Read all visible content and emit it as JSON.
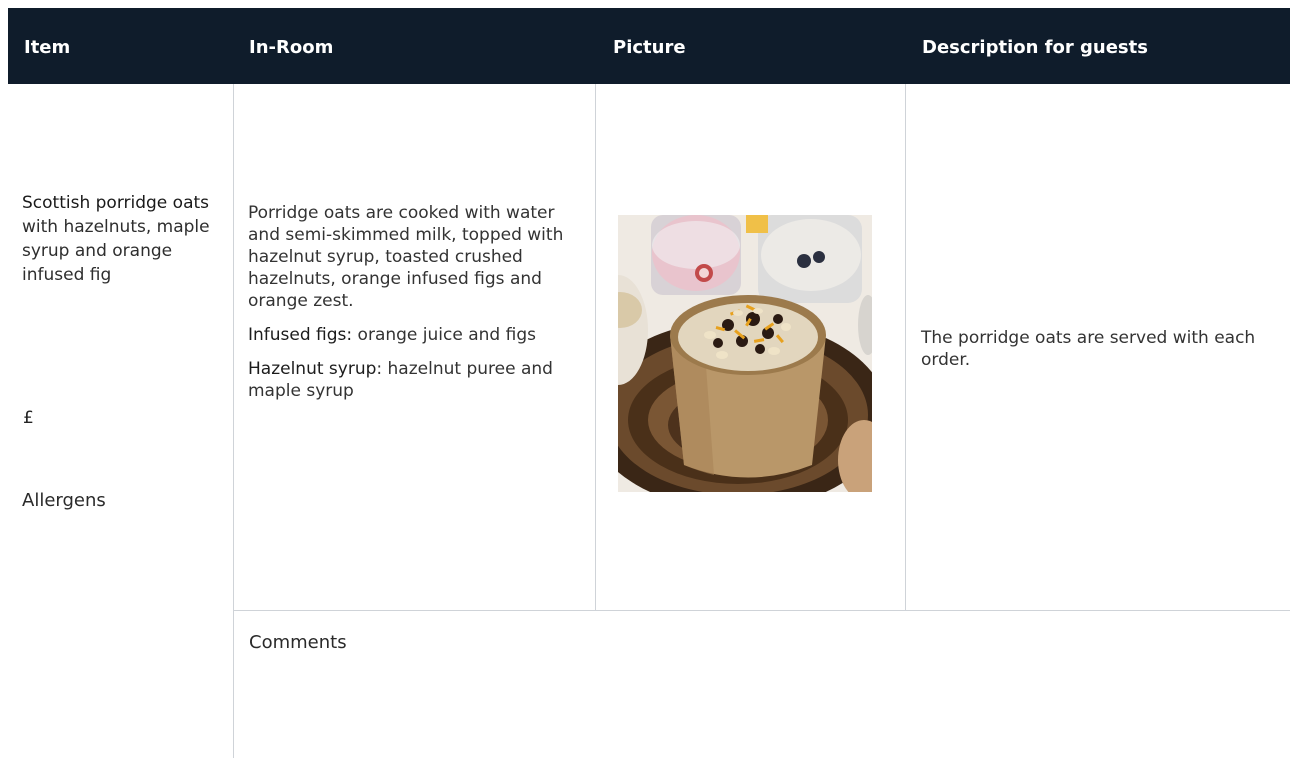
{
  "table": {
    "headers": {
      "item": "Item",
      "in_room": "In-Room",
      "picture": "Picture",
      "description": "Description for guests"
    },
    "row": {
      "item_name_bold": "Scottish porridge oats",
      "item_name_rest": " with hazelnuts, maple syrup and orange infused fig",
      "price": "£",
      "allergens": "Allergens",
      "in_room_text": "Porridge oats are cooked with water and semi-skimmed milk, topped with hazelnut syrup, toasted crushed hazelnuts, orange infused figs and orange zest.",
      "infused_figs_label": "Infused figs:",
      "infused_figs_text": " orange juice and figs",
      "hazelnut_syrup_label": "Hazelnut syrup",
      "hazelnut_syrup_text": ": hazelnut puree and maple syrup",
      "picture_subject": "porridge-pot-photo",
      "description": "The porridge oats are served with each order."
    },
    "comments_label": "Comments"
  },
  "colors": {
    "header_bg": "#0f1c2b",
    "header_text": "#ffffff",
    "rule": "#cfd3d8"
  }
}
